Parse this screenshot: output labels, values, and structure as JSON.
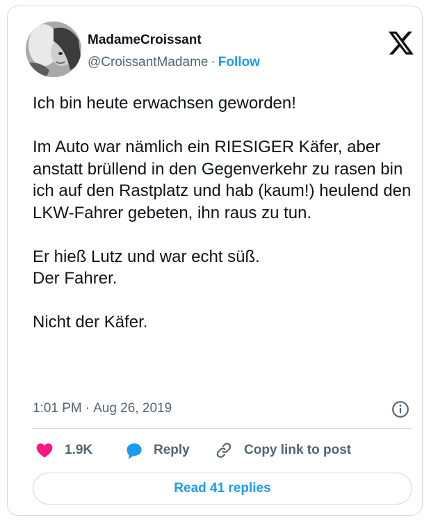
{
  "author": {
    "display_name": "MadameCroissant",
    "handle": "@CroissantMadame",
    "separator": "·",
    "follow_label": "Follow"
  },
  "tweet": {
    "paragraphs": [
      "Ich bin heute erwachsen geworden!",
      "Im Auto war nämlich ein RIESIGER Käfer, aber anstatt brüllend in den Gegenverkehr zu rasen bin ich auf den Rastplatz und hab (kaum!) heulend den LKW-Fahrer gebeten, ihn raus zu tun.",
      "Er hieß Lutz und war echt süß.",
      "Der Fahrer.",
      "Nicht der Käfer."
    ],
    "time": "1:01 PM",
    "separator": "·",
    "date": "Aug 26, 2019"
  },
  "actions": {
    "like_count": "1.9K",
    "reply_label": "Reply",
    "copy_label": "Copy link to post"
  },
  "read_replies_label": "Read 41 replies",
  "colors": {
    "accent": "#1d9bf0",
    "heart": "#f91880",
    "reply_bubble": "#1d9bf0",
    "text": "#0f1419",
    "muted": "#536471",
    "border": "#cfd9de"
  },
  "icons": {
    "brand": "x-logo-icon",
    "info": "info-icon",
    "like": "heart-icon",
    "reply": "speech-bubble-icon",
    "copy": "link-icon"
  }
}
